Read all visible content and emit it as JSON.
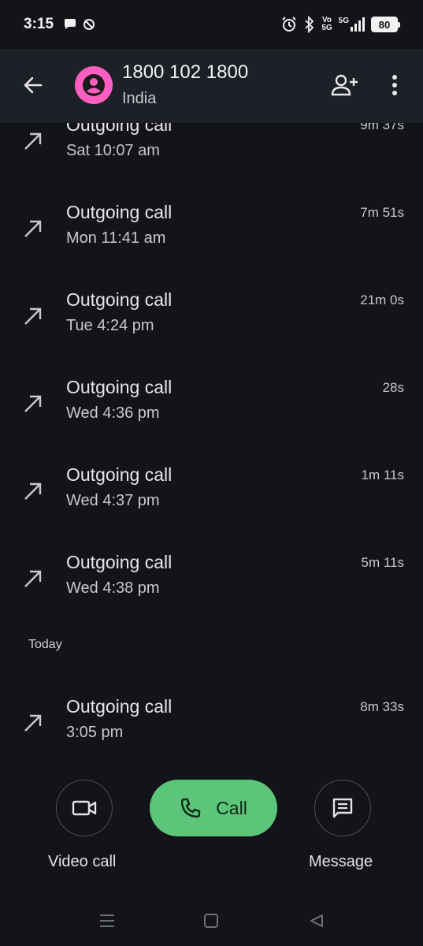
{
  "status_bar": {
    "time": "3:15",
    "battery": "80",
    "network": "5G",
    "volte": "Vo 5G",
    "icons": [
      "chat-icon",
      "no-disturb-icon",
      "alarm-icon",
      "bluetooth-icon",
      "signal-icon"
    ]
  },
  "header": {
    "title": "1800 102 1800",
    "subtitle": "India",
    "avatar_color": "#ff5fc0"
  },
  "calls_before": [
    {
      "type": "Outgoing call",
      "time": "Sat 10:07 am",
      "duration": "9m 37s"
    },
    {
      "type": "Outgoing call",
      "time": "Mon 11:41 am",
      "duration": "7m 51s"
    },
    {
      "type": "Outgoing call",
      "time": "Tue 4:24 pm",
      "duration": "21m 0s"
    },
    {
      "type": "Outgoing call",
      "time": "Wed 4:36 pm",
      "duration": "28s"
    },
    {
      "type": "Outgoing call",
      "time": "Wed 4:37 pm",
      "duration": "1m 11s"
    },
    {
      "type": "Outgoing call",
      "time": "Wed 4:38 pm",
      "duration": "5m 11s"
    }
  ],
  "today_label": "Today",
  "calls_today": [
    {
      "type": "Outgoing call",
      "time": "3:05 pm",
      "duration": "8m 33s"
    }
  ],
  "actions": {
    "video_label": "Video call",
    "call_label": "Call",
    "message_label": "Message",
    "call_color": "#5cc579"
  }
}
